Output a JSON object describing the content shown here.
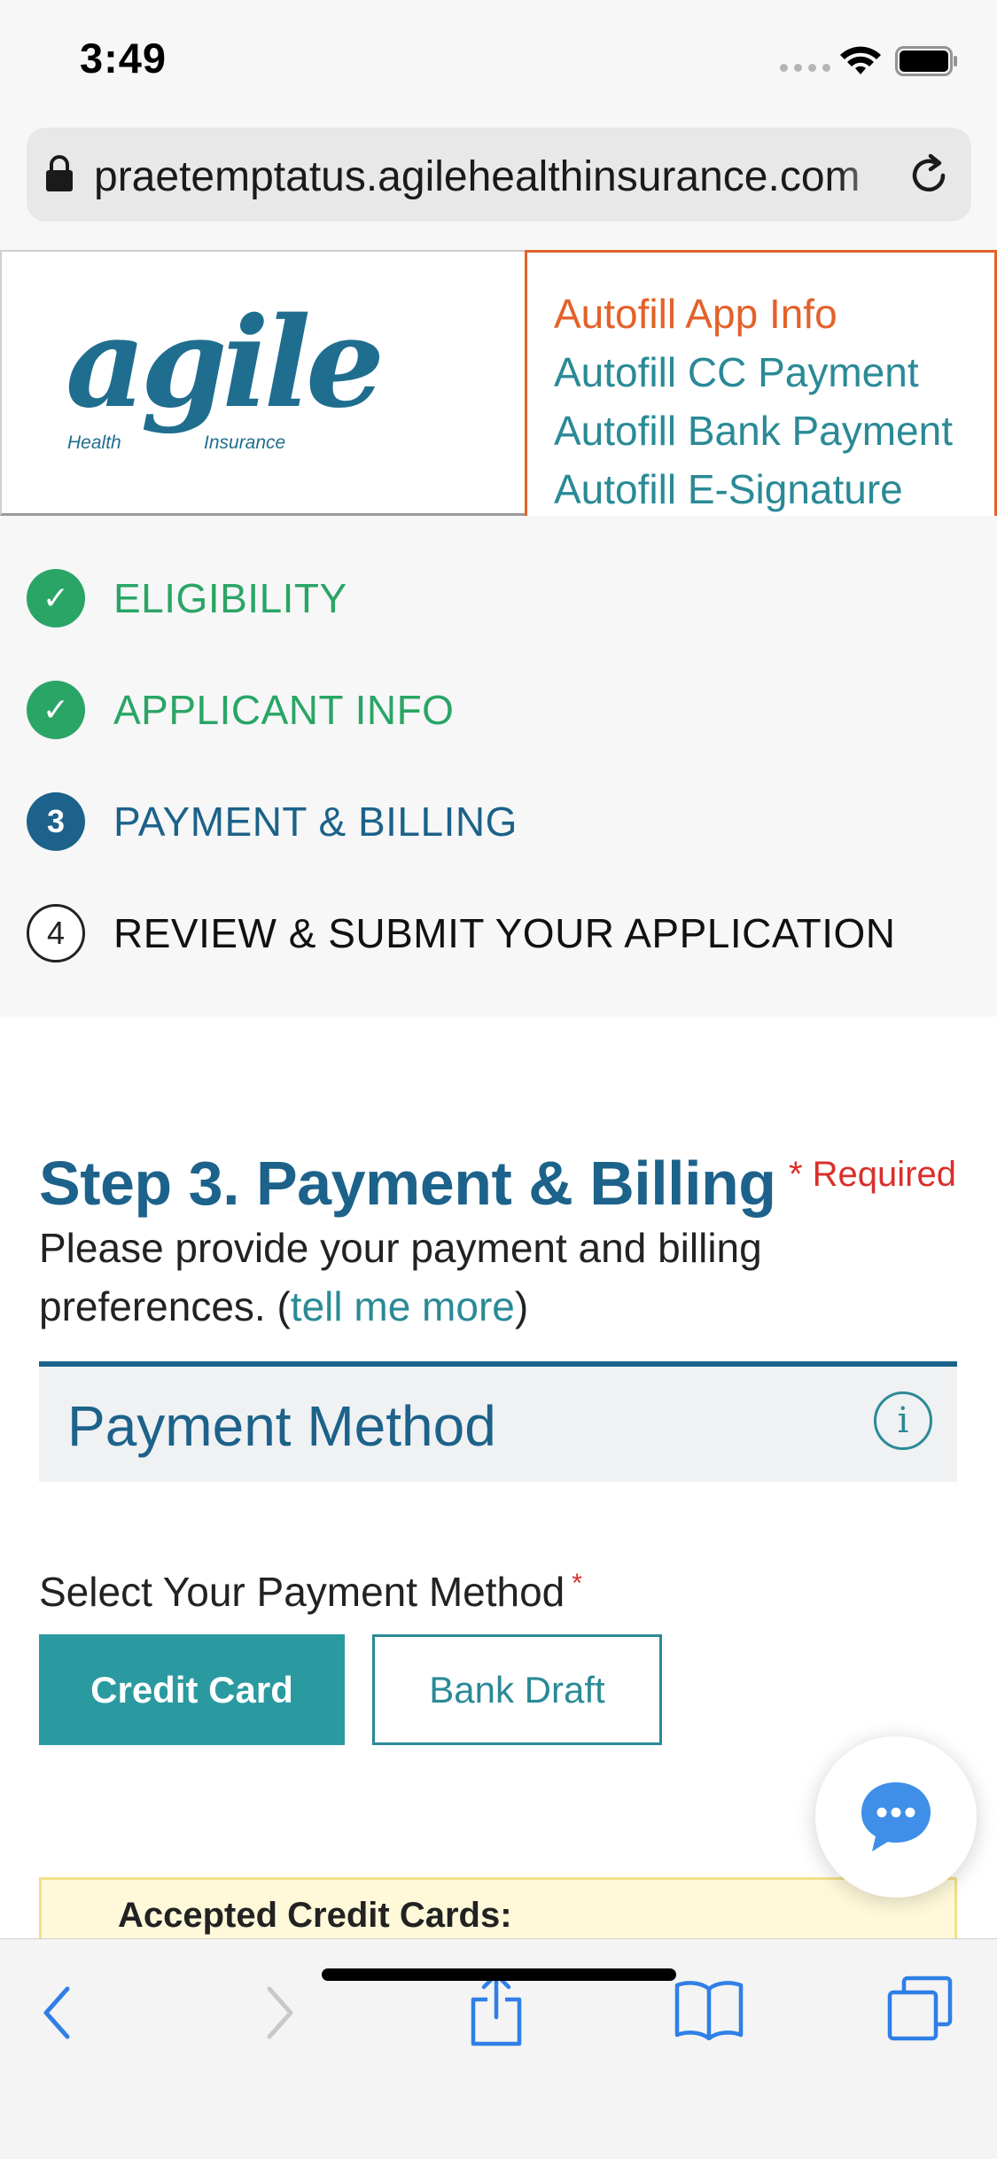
{
  "status_bar": {
    "time": "3:49"
  },
  "browser": {
    "url": "praetemptatus.agilehealthinsurance.com"
  },
  "logo": {
    "wordmark": "agile",
    "health": "Health",
    "insurance": "Insurance",
    "reg": "®"
  },
  "autofill": {
    "items": [
      {
        "label": "Autofill App Info"
      },
      {
        "label": "Autofill CC Payment"
      },
      {
        "label": "Autofill Bank Payment"
      },
      {
        "label": "Autofill E-Signature"
      }
    ]
  },
  "steps": [
    {
      "marker": "✓",
      "label": "ELIGIBILITY",
      "state": "done"
    },
    {
      "marker": "✓",
      "label": "APPLICANT INFO",
      "state": "done"
    },
    {
      "marker": "3",
      "label": "PAYMENT & BILLING",
      "state": "current"
    },
    {
      "marker": "4",
      "label": "REVIEW & SUBMIT YOUR APPLICATION",
      "state": "pending"
    }
  ],
  "main": {
    "title": "Step 3. Payment & Billing",
    "required_note": "* Required",
    "intro_prefix": "Please provide your payment and billing preferences. (",
    "intro_link": "tell me more",
    "intro_suffix": ")",
    "section_title": "Payment Method",
    "info_glyph": "i",
    "select_label": "Select Your Payment Method",
    "required_star": "*",
    "credit_card_label": "Credit Card",
    "bank_draft_label": "Bank Draft",
    "accepted_cards_title": "Accepted Credit Cards:"
  },
  "colors": {
    "brand_blue": "#1c628a",
    "teal": "#2a8a96",
    "green": "#2aa566",
    "orange": "#e2622a",
    "required_red": "#d9302c",
    "chat_blue": "#3f8ee8"
  }
}
